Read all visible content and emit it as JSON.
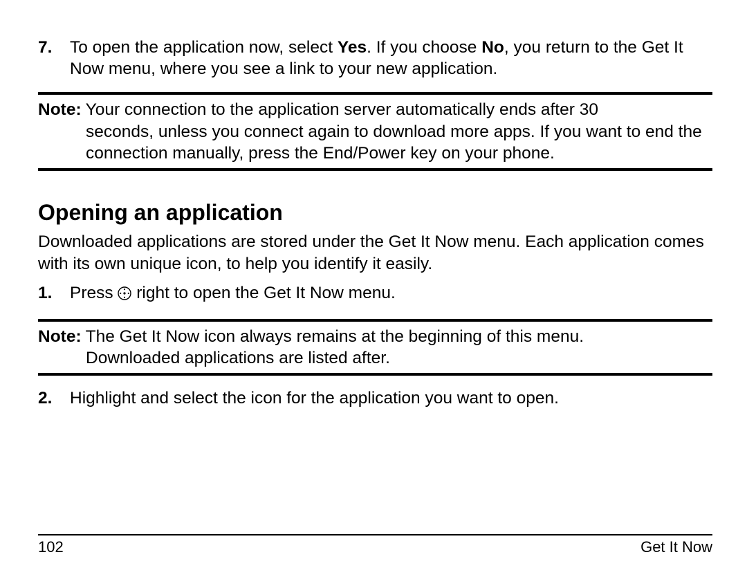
{
  "step7": {
    "num": "7.",
    "text_before_yes": "To open the application now, select ",
    "yes": "Yes",
    "text_mid": ". If you choose ",
    "no": "No",
    "text_after": ", you return to the Get It Now menu, where you see a link to your new application."
  },
  "note1": {
    "label": "Note:",
    "body_first": "Your connection to the application server automatically ends after 30",
    "body_rest": "seconds, unless you connect again to download more apps. If you want to end the connection manually, press the End/Power key on your phone."
  },
  "heading": "Opening an application",
  "intro": "Downloaded applications are stored under the Get It Now menu. Each application comes with its own unique icon, to help you identify it easily.",
  "step1": {
    "num": "1.",
    "text_before_icon": "Press ",
    "text_after_icon": " right to open the Get It Now menu."
  },
  "note2": {
    "label": "Note:",
    "body_first": "The Get It Now icon always remains at the beginning of this menu.",
    "body_rest": "Downloaded applications are listed after."
  },
  "step2": {
    "num": "2.",
    "text": "Highlight and select the icon for the application you want to open."
  },
  "footer": {
    "page": "102",
    "chapter": "Get It Now"
  }
}
